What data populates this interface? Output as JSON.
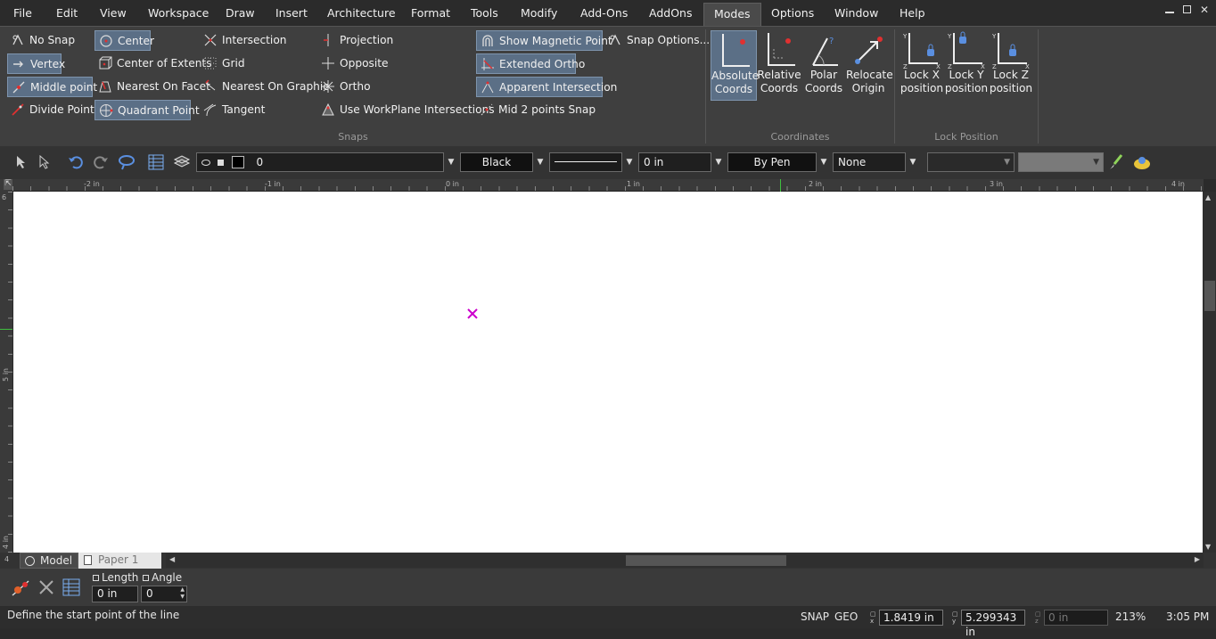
{
  "menu": {
    "items": [
      "File",
      "Edit",
      "View",
      "Workspace",
      "Draw",
      "Insert",
      "Architecture",
      "Format",
      "Tools",
      "Modify",
      "Add-Ons",
      "AddOns",
      "Modes",
      "Options",
      "Window",
      "Help"
    ],
    "active": "Modes"
  },
  "ribbon": {
    "snaps": {
      "label": "Snaps",
      "items": [
        {
          "label": "No Snap",
          "icon": "no-snap-icon",
          "selected": false
        },
        {
          "label": "Vertex",
          "icon": "vertex-icon",
          "selected": true
        },
        {
          "label": "Middle point",
          "icon": "middle-point-icon",
          "selected": true
        },
        {
          "label": "Divide Point",
          "icon": "divide-point-icon",
          "selected": false
        },
        {
          "label": "Center",
          "icon": "center-icon",
          "selected": true
        },
        {
          "label": "Center of Extents",
          "icon": "center-extents-icon",
          "selected": false
        },
        {
          "label": "Nearest On Facet",
          "icon": "nearest-facet-icon",
          "selected": false
        },
        {
          "label": "Quadrant Point",
          "icon": "quadrant-point-icon",
          "selected": true
        },
        {
          "label": "Intersection",
          "icon": "intersection-icon",
          "selected": false
        },
        {
          "label": "Grid",
          "icon": "grid-icon",
          "selected": false
        },
        {
          "label": "Nearest On Graphic",
          "icon": "nearest-graphic-icon",
          "selected": false
        },
        {
          "label": "Tangent",
          "icon": "tangent-icon",
          "selected": false
        },
        {
          "label": "Projection",
          "icon": "projection-icon",
          "selected": false
        },
        {
          "label": "Opposite",
          "icon": "opposite-icon",
          "selected": false
        },
        {
          "label": "Ortho",
          "icon": "ortho-icon",
          "selected": false
        },
        {
          "label": "Use WorkPlane Intersections",
          "icon": "workplane-icon",
          "selected": false
        },
        {
          "label": "Show Magnetic Point",
          "icon": "magnet-icon",
          "selected": true
        },
        {
          "label": "Extended Ortho",
          "icon": "extended-ortho-icon",
          "selected": true
        },
        {
          "label": "Apparent Intersection",
          "icon": "apparent-intersection-icon",
          "selected": true
        },
        {
          "label": "Mid 2 points Snap",
          "icon": "mid-two-points-icon",
          "selected": false
        },
        {
          "label": "Snap Options...",
          "icon": "snap-options-icon",
          "selected": false
        }
      ]
    },
    "coordinates": {
      "label": "Coordinates",
      "items": [
        {
          "line1": "Absolute",
          "line2": "Coords",
          "selected": true
        },
        {
          "line1": "Relative",
          "line2": "Coords",
          "selected": false
        },
        {
          "line1": "Polar",
          "line2": "Coords",
          "selected": false
        },
        {
          "line1": "Relocate",
          "line2": "Origin",
          "selected": false
        }
      ]
    },
    "lock": {
      "label": "Lock Position",
      "items": [
        {
          "line1": "Lock X",
          "line2": "position"
        },
        {
          "line1": "Lock Y",
          "line2": "position"
        },
        {
          "line1": "Lock Z",
          "line2": "position"
        }
      ]
    }
  },
  "toolbar": {
    "layer": "0",
    "color": "Black",
    "line_width": "0 in",
    "pen": "By Pen",
    "fill": "None"
  },
  "ruler": {
    "top_labels": [
      "-2 in",
      "-1 in",
      "0 in",
      "1 in",
      "2 in",
      "3 in",
      "4 in"
    ],
    "left_labels": [
      "6",
      "5 in",
      "4 in"
    ]
  },
  "tabs": {
    "model": "Model",
    "paper": "Paper 1"
  },
  "cmd": {
    "length_label": "Length",
    "length_value": "0 in",
    "angle_label": "Angle",
    "angle_value": "0"
  },
  "status": {
    "prompt": "Define the start point of the line",
    "snap": "SNAP",
    "geo": "GEO",
    "x": "1.8419 in",
    "y": "5.299343 in",
    "z": "0 in",
    "zoom": "213%",
    "time": "3:05 PM"
  },
  "colors": {
    "accent": "#5b6f86",
    "marker": "#cc00cc",
    "lock": "#5a8fe0"
  }
}
